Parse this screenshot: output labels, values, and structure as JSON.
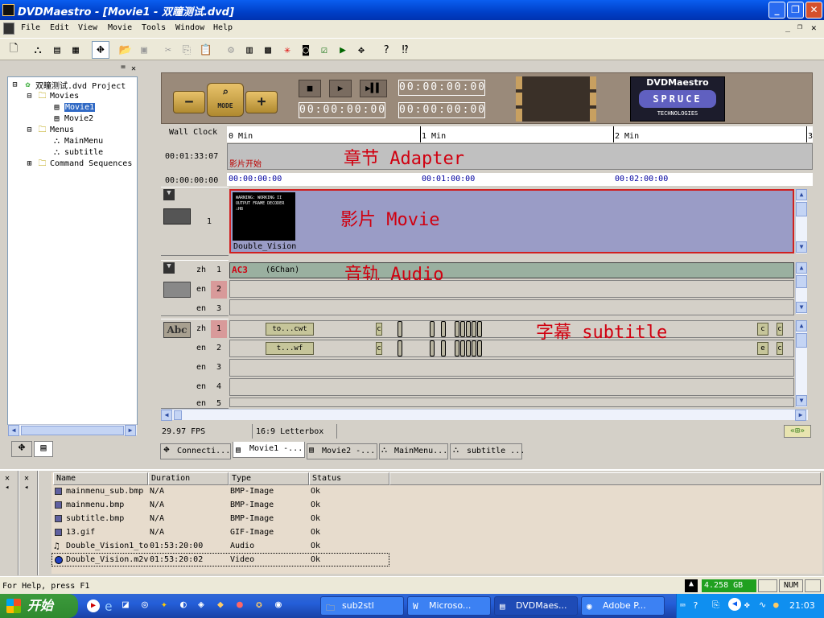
{
  "window": {
    "title": "DVDMaestro - [Movie1 - 双瞳测试.dvd]"
  },
  "menu": {
    "file": "File",
    "edit": "Edit",
    "view": "View",
    "movie": "Movie",
    "tools": "Tools",
    "window": "Window",
    "help": "Help"
  },
  "tree": {
    "project": "双瞳测试.dvd Project",
    "movies": "Movies",
    "movie1": "Movie1",
    "movie2": "Movie2",
    "menus": "Menus",
    "mainmenu": "MainMenu",
    "subtitle": "subtitle",
    "command_sequences": "Command Sequences"
  },
  "transport": {
    "mode_label": "MODE",
    "minus": "−",
    "plus": "+",
    "counter_placeholder": "00:00:00:00",
    "brand": "DVDMaestro",
    "brand_sub": "SPRUCE",
    "brand_tech": "TECHNOLOGIES"
  },
  "timeline": {
    "wall_clock_label": "Wall Clock",
    "wall_clock_value": "00:01:33:07",
    "position": "00:00:00:00",
    "ruler_marks": [
      "0 Min",
      "1 Min",
      "2 Min",
      "3"
    ],
    "timecodes": [
      "00:00:00:00",
      "00:01:00:00",
      "00:02:00:00"
    ],
    "chapter_marker": "影片开始",
    "chapter_annotation": "章节 Adapter",
    "movie_annotation": "影片 Movie",
    "audio_annotation": "音轨 Audio",
    "subtitle_annotation": "字幕 subtitle",
    "video_track_num": "1",
    "video_clip_name": "Double_Vision",
    "video_thumb_text": "WARNING: WORKING II OUTPUT FRAME DECODER ∴H8",
    "audio_tracks": [
      {
        "lang": "zh",
        "num": "1"
      },
      {
        "lang": "en",
        "num": "2"
      },
      {
        "lang": "en",
        "num": "3"
      }
    ],
    "audio_clip_codec": "AC3",
    "audio_clip_channels": "(6Chan)",
    "sub_tracks": [
      {
        "lang": "zh",
        "num": "1"
      },
      {
        "lang": "en",
        "num": "2"
      },
      {
        "lang": "en",
        "num": "3"
      },
      {
        "lang": "en",
        "num": "4"
      },
      {
        "lang": "en",
        "num": "5"
      }
    ],
    "sub_clip1": "to...cwt",
    "sub_clip2": "t...wf",
    "sub_small": [
      "c",
      "c",
      "c",
      "c",
      "e",
      "c"
    ],
    "abc_label": "Abc"
  },
  "editor_status": {
    "fps": "29.97 FPS",
    "aspect": "16:9 Letterbox"
  },
  "tabs": [
    "Connecti...",
    "Movie1 -...",
    "Movie2 -...",
    "MainMenu...",
    "subtitle ..."
  ],
  "assets": {
    "headers": [
      "Name",
      "Duration",
      "Type",
      "Status"
    ],
    "rows": [
      {
        "name": "mainmenu_sub.bmp",
        "duration": "N/A",
        "type": "BMP-Image",
        "status": "Ok"
      },
      {
        "name": "mainmenu.bmp",
        "duration": "N/A",
        "type": "BMP-Image",
        "status": "Ok"
      },
      {
        "name": "subtitle.bmp",
        "duration": "N/A",
        "type": "BMP-Image",
        "status": "Ok"
      },
      {
        "name": "13.gif",
        "duration": "N/A",
        "type": "GIF-Image",
        "status": "Ok"
      },
      {
        "name": "Double_Vision1_to",
        "duration": "01:53:20:00",
        "type": "Audio",
        "status": "Ok"
      },
      {
        "name": "Double_Vision.m2v",
        "duration": "01:53:20:02",
        "type": "Video",
        "status": "Ok"
      }
    ]
  },
  "status": {
    "help": "For Help, press F1",
    "disk": "4.258 GB",
    "num": "NUM"
  },
  "taskbar": {
    "start": "开始",
    "tasks": [
      "sub2stl",
      "Microso...",
      "DVDMaes...",
      "Adobe P..."
    ],
    "clock": "21:03"
  },
  "colors": {
    "accent": "#0a5ef0",
    "red_annotation": "#d00010",
    "track": "#9a9cc6"
  }
}
